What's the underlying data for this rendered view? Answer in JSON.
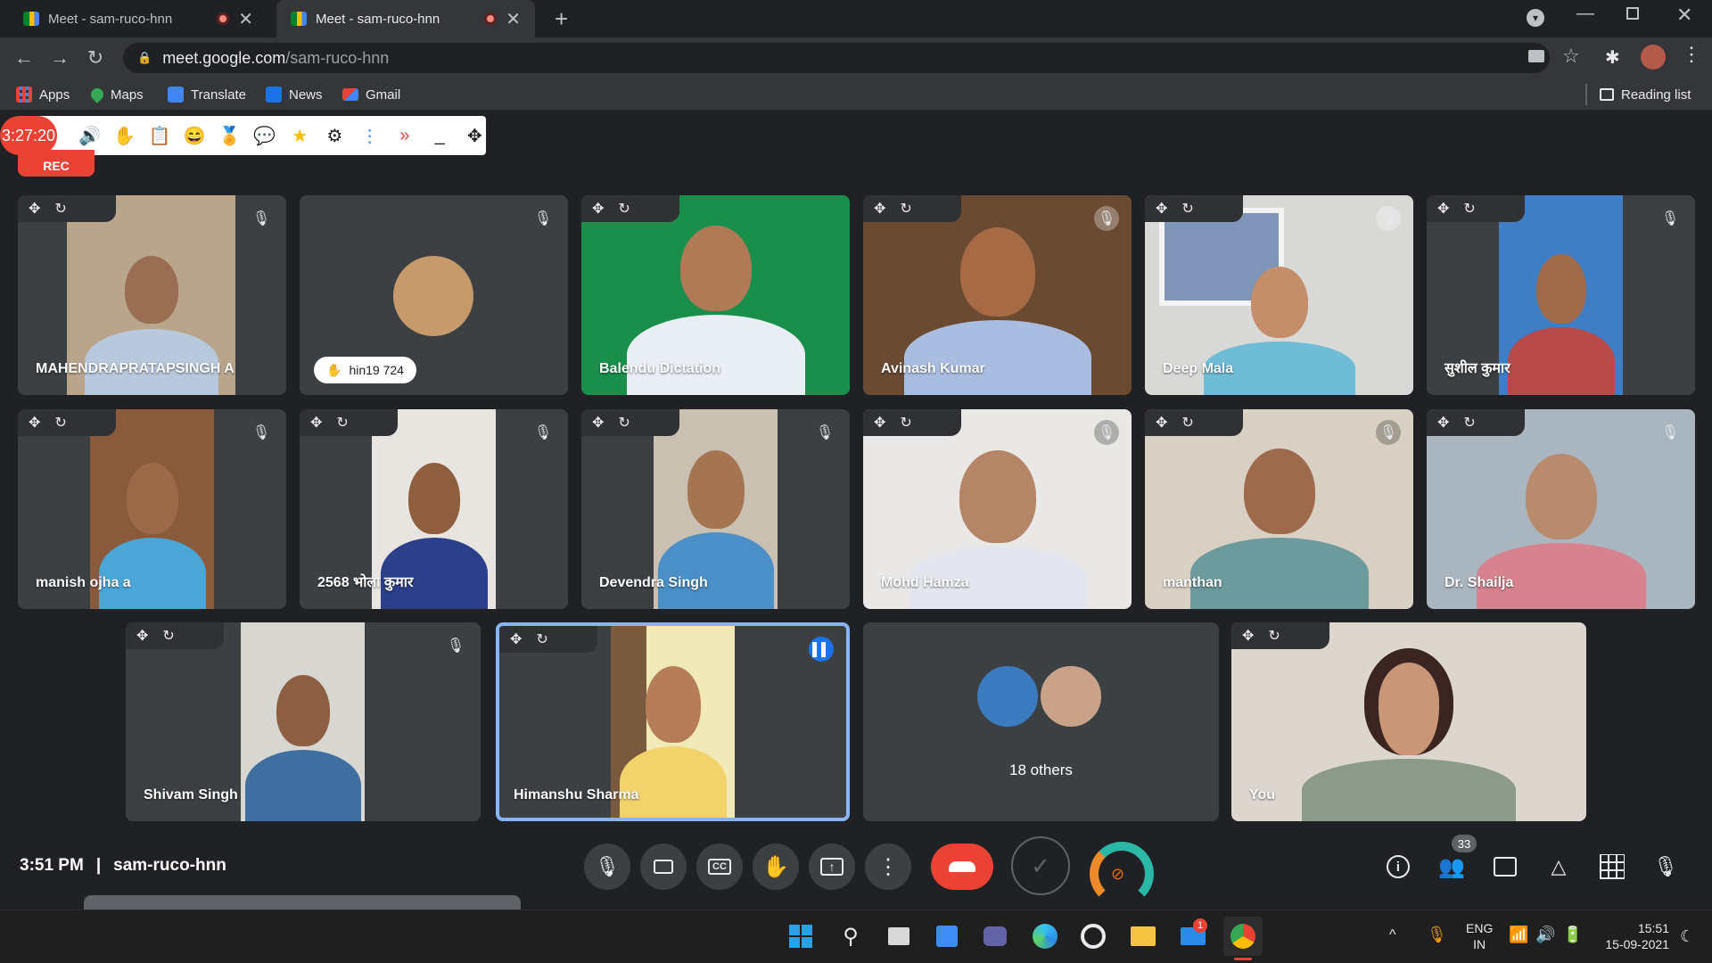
{
  "browser": {
    "tabs": [
      {
        "title": "Meet - sam-ruco-hnn"
      },
      {
        "title": "Meet - sam-ruco-hnn"
      }
    ],
    "url_host": "meet.google.com",
    "url_path": "/sam-ruco-hnn",
    "bookmarks": [
      "Apps",
      "Maps",
      "Translate",
      "News",
      "Gmail"
    ],
    "reading_list": "Reading list"
  },
  "extension": {
    "timer": "3:27:20",
    "rec_label": "REC"
  },
  "participants": [
    {
      "name": "MAHENDRAPRATAPSINGH A",
      "bg": "#b9a48c",
      "shirt": "#b8c8dd",
      "skin": "#9a6e52"
    },
    {
      "name": "hin19 724",
      "bg": "#3c4043",
      "avatar": "#c79a6b"
    },
    {
      "name": "Balendu Dictation",
      "bg": "#1a8f4c",
      "shirt": "#e9eef4",
      "skin": "#b07a56"
    },
    {
      "name": "Avinash Kumar",
      "bg": "#6b4a32",
      "shirt": "#a9bde0",
      "skin": "#a66b45"
    },
    {
      "name": "Deep Mala",
      "bg": "#d8d8d6",
      "shirt": "#6fbcd6",
      "skin": "#c58e6a"
    },
    {
      "name": "सुशील कुमार",
      "bg": "#3f7ec4",
      "shirt": "#b84a4a",
      "skin": "#a06b4a"
    },
    {
      "name": "manish ojha a",
      "bg": "#8a5a3c",
      "shirt": "#4aa6d6",
      "skin": "#9c6a48"
    },
    {
      "name": "2568 भोला कुमार",
      "bg": "#e8e4e0",
      "shirt": "#2b3f8a",
      "skin": "#8e5e3e"
    },
    {
      "name": "Devendra Singh",
      "bg": "#c9c0b2",
      "shirt": "#4a8fc7",
      "skin": "#a57552"
    },
    {
      "name": "Mohd Hamza",
      "bg": "#e9e8e6",
      "shirt": "#e3e6ee",
      "skin": "#b48566"
    },
    {
      "name": "manthan",
      "bg": "#d8d0c2",
      "shirt": "#6d9a9c",
      "skin": "#9e6a4c"
    },
    {
      "name": "Dr. Shailja",
      "bg": "#a9b6c0",
      "shirt": "#d6838f",
      "skin": "#b88a6e"
    },
    {
      "name": "Shivam Singh",
      "bg": "#d8d6d0",
      "shirt": "#3f6fa0",
      "skin": "#8d5f42"
    },
    {
      "name": "Himanshu Sharma",
      "bg": "#f1e9b8",
      "shirt": "#f2d36b",
      "skin": "#b57e58"
    },
    {
      "name": "18 others"
    },
    {
      "name": "You",
      "bg": "#dcd6cf",
      "shirt": "#8c9a8a",
      "skin": "#c99678"
    }
  ],
  "footer": {
    "time": "3:51 PM",
    "separator": "|",
    "meeting_code": "sam-ruco-hnn",
    "people_count": "33"
  },
  "taskbar": {
    "lang_top": "ENG",
    "lang_bottom": "IN",
    "clock_time": "15:51",
    "clock_date": "15-09-2021",
    "mail_badge": "1"
  },
  "colors": {
    "accent_blue": "#8ab4f8",
    "end_call_red": "#ea4335",
    "speaking_blue": "#1a73e8"
  }
}
